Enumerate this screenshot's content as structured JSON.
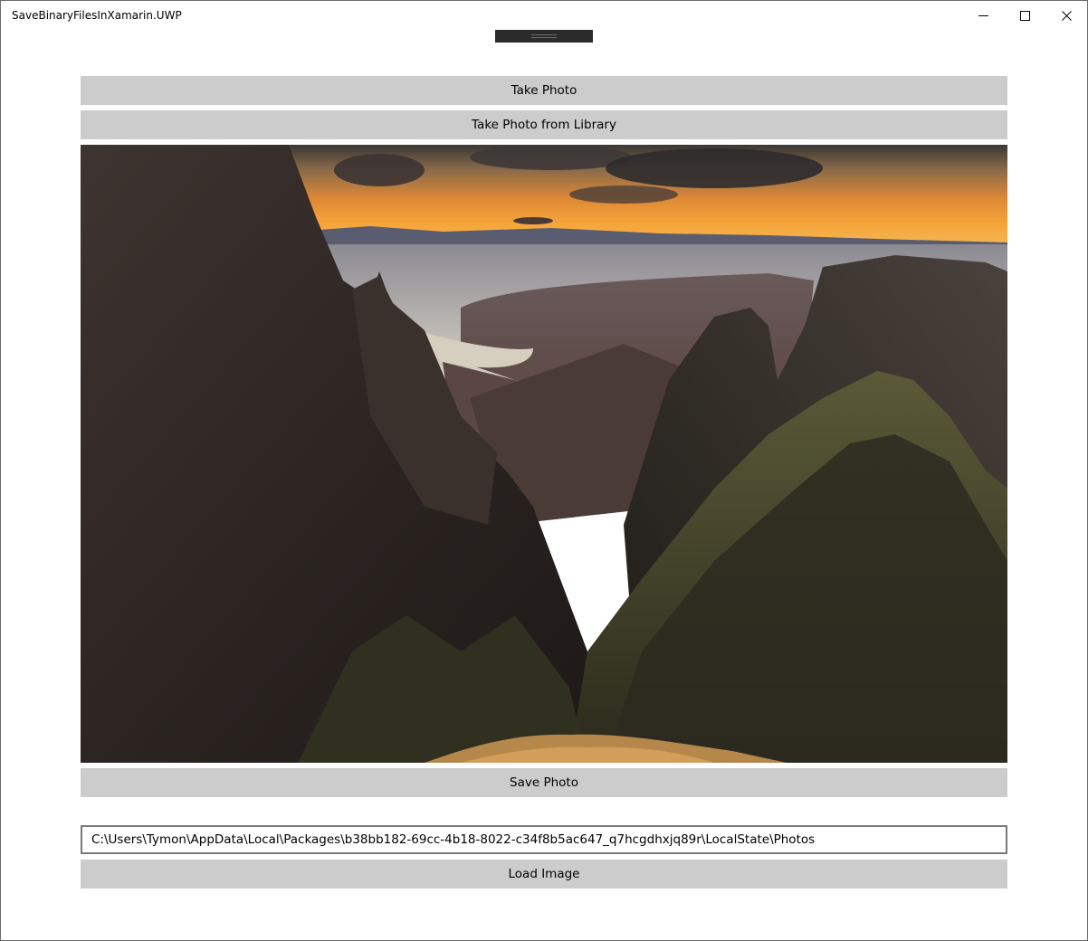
{
  "window": {
    "title": "SaveBinaryFilesInXamarin.UWP"
  },
  "buttons": {
    "take_photo": "Take Photo",
    "take_photo_library": "Take Photo from Library",
    "save_photo": "Save Photo",
    "load_image": "Load Image"
  },
  "path_field": {
    "value": "C:\\Users\\Tymon\\AppData\\Local\\Packages\\b38bb182-69cc-4b18-8022-c34f8b5ac647_q7hcgdhxjq89r\\LocalState\\Photos"
  },
  "icons": {
    "minimize": "minimize-icon",
    "maximize": "maximize-icon",
    "close": "close-icon"
  }
}
